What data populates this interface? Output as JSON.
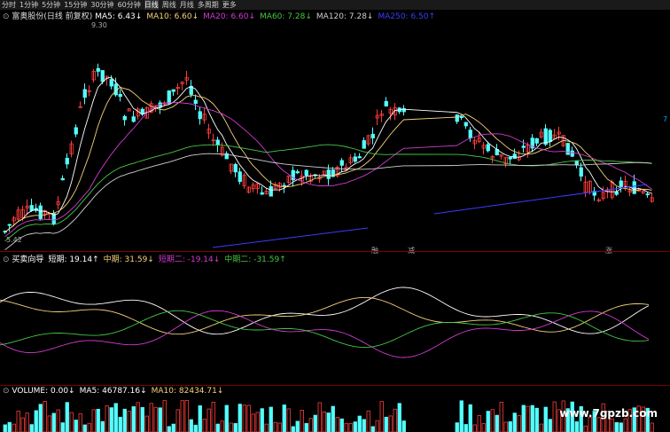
{
  "toolbar": {
    "timeframes": [
      "分时",
      "1分钟",
      "5分钟",
      "15分钟",
      "30分钟",
      "60分钟",
      "日线",
      "周线",
      "月线",
      "多周期",
      "更多"
    ],
    "active_index": 6
  },
  "main_legend": {
    "title": "富奥股份(日线 前复权)",
    "items": [
      {
        "text": "MA5: 6.43↓",
        "color": "#ffffff"
      },
      {
        "text": "MA10: 6.60↓",
        "color": "#f5d27a"
      },
      {
        "text": "MA20: 6.60↓",
        "color": "#d23bd2"
      },
      {
        "text": "MA60: 7.28↓",
        "color": "#46c746"
      },
      {
        "text": "MA120: 7.28↓",
        "color": "#cfcfcf"
      },
      {
        "text": "MA250: 6.50↑",
        "color": "#3c3cff"
      }
    ]
  },
  "price_labels": {
    "high": "9.30",
    "low": "5.42",
    "right_edge": "7"
  },
  "markers": [
    {
      "text": "融",
      "color": "#00aaff"
    },
    {
      "text": "减",
      "color": "#00c000"
    },
    {
      "text": "涨",
      "color": "#ff4040"
    }
  ],
  "osc_legend": {
    "items": [
      {
        "text": "买卖向导",
        "color": "#ffffff"
      },
      {
        "text": "短期: 19.14↑",
        "color": "#ffffff"
      },
      {
        "text": "中期: 31.59↓",
        "color": "#f5d27a"
      },
      {
        "text": "短期二: -19.14↓",
        "color": "#d23bd2"
      },
      {
        "text": "中期二: -31.59↑",
        "color": "#46c746"
      }
    ]
  },
  "vol_legend": {
    "items": [
      {
        "text": "VOLUME: 0.00↓",
        "color": "#ffffff"
      },
      {
        "text": "MA5: 46787.16↓",
        "color": "#ffffff"
      },
      {
        "text": "MA10: 82434.71↓",
        "color": "#f5d27a"
      }
    ]
  },
  "watermark": "www.7gpzb.com",
  "colors": {
    "up": "#ff3b3b",
    "down": "#54ffff"
  }
}
